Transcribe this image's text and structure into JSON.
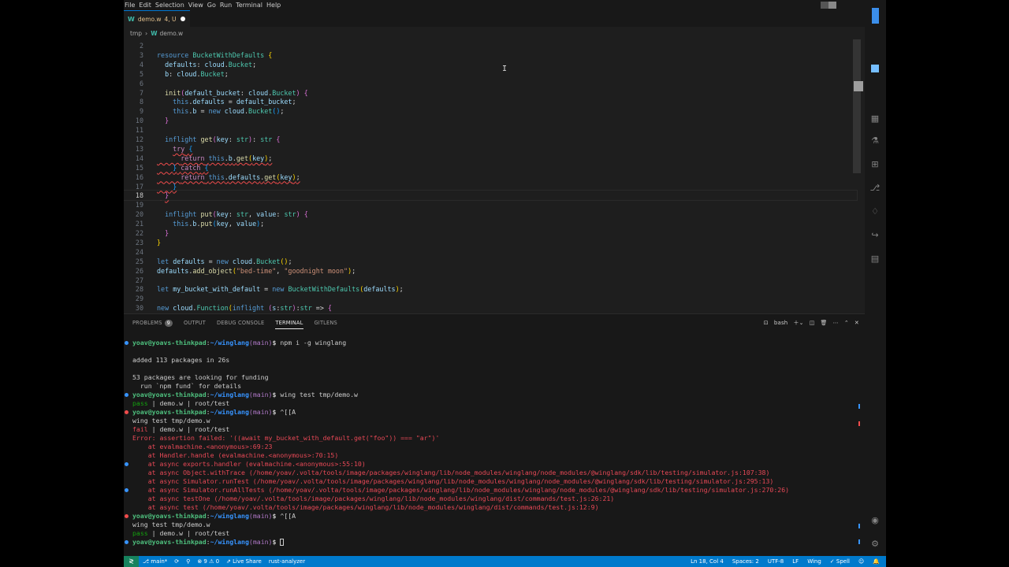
{
  "menubar": {
    "items": [
      "File",
      "Edit",
      "Selection",
      "View",
      "Go",
      "Run",
      "Terminal",
      "Help"
    ]
  },
  "tab": {
    "label": "demo.w",
    "status": "4, U"
  },
  "breadcrumb": {
    "folder": "tmp",
    "file": "demo.w"
  },
  "editor": {
    "lines": [
      {
        "n": "2",
        "html": ""
      },
      {
        "n": "3",
        "html": "<span class='k'>resource</span> <span class='t'>BucketWithDefaults</span> <span class='bk'>{</span>"
      },
      {
        "n": "4",
        "html": "  <span class='v'>defaults</span>: <span class='v'>cloud</span>.<span class='t'>Bucket</span>;"
      },
      {
        "n": "5",
        "html": "  <span class='v'>b</span>: <span class='v'>cloud</span>.<span class='t'>Bucket</span>;"
      },
      {
        "n": "6",
        "html": ""
      },
      {
        "n": "7",
        "html": "  <span class='f'>init</span><span class='bk2'>(</span><span class='v'>default_bucket</span>: <span class='v'>cloud</span>.<span class='t'>Bucket</span><span class='bk2'>)</span> <span class='bk2'>{</span>"
      },
      {
        "n": "8",
        "html": "    <span class='k'>this</span>.<span class='v'>defaults</span> = <span class='v'>default_bucket</span>;"
      },
      {
        "n": "9",
        "html": "    <span class='k'>this</span>.<span class='v'>b</span> = <span class='k'>new</span> <span class='v'>cloud</span>.<span class='t'>Bucket</span><span class='bk3'>()</span>;"
      },
      {
        "n": "10",
        "html": "  <span class='bk2'>}</span>"
      },
      {
        "n": "11",
        "html": ""
      },
      {
        "n": "12",
        "html": "  <span class='k'>inflight</span> <span class='f'>get</span><span class='bk2'>(</span><span class='v'>key</span>: <span class='t'>str</span><span class='bk2'>)</span>: <span class='t'>str</span> <span class='bk2'>{</span>"
      },
      {
        "n": "13",
        "html": "    <span class='squig'><span class='kc'>try</span> <span class='bk3'>{</span></span>"
      },
      {
        "n": "14",
        "html": "<span class='squig'>      <span class='kc'>return</span> <span class='k'>this</span>.<span class='v'>b</span>.<span class='f'>get</span><span class='bk'>(</span><span class='v'>key</span><span class='bk'>)</span>;</span>"
      },
      {
        "n": "15",
        "html": "<span class='squig'>    <span class='bk3'>}</span> <span class='kc'>catch</span> <span class='bk3'>{</span></span>"
      },
      {
        "n": "16",
        "html": "<span class='squig'>      <span class='kc'>return</span> <span class='k'>this</span>.<span class='v'>defaults</span>.<span class='f'>get</span><span class='bk'>(</span><span class='v'>key</span><span class='bk'>)</span>;</span>"
      },
      {
        "n": "17",
        "html": "<span class='squig'>    <span class='bk3'>}</span></span>"
      },
      {
        "n": "18",
        "html": "<span class='squig'>  <span class='bk2'>}</span></span>"
      },
      {
        "n": "19",
        "html": ""
      },
      {
        "n": "20",
        "html": "  <span class='k'>inflight</span> <span class='f'>put</span><span class='bk2'>(</span><span class='v'>key</span>: <span class='t'>str</span>, <span class='v'>value</span>: <span class='t'>str</span><span class='bk2'>)</span> <span class='bk2'>{</span>"
      },
      {
        "n": "21",
        "html": "    <span class='k'>this</span>.<span class='v'>b</span>.<span class='f'>put</span><span class='bk3'>(</span><span class='v'>key</span>, <span class='v'>value</span><span class='bk3'>)</span>;"
      },
      {
        "n": "22",
        "html": "  <span class='bk2'>}</span>"
      },
      {
        "n": "23",
        "html": "<span class='bk'>}</span>"
      },
      {
        "n": "24",
        "html": ""
      },
      {
        "n": "25",
        "html": "<span class='k'>let</span> <span class='v'>defaults</span> = <span class='k'>new</span> <span class='v'>cloud</span>.<span class='t'>Bucket</span><span class='bk'>()</span>;"
      },
      {
        "n": "26",
        "html": "<span class='v'>defaults</span>.<span class='f'>add_object</span><span class='bk'>(</span><span class='s'>\"bed-time\"</span>, <span class='s'>\"goodnight moon\"</span><span class='bk'>)</span>;"
      },
      {
        "n": "27",
        "html": ""
      },
      {
        "n": "28",
        "html": "<span class='k'>let</span> <span class='v'>my_bucket_with_default</span> = <span class='k'>new</span> <span class='t'>BucketWithDefaults</span><span class='bk'>(</span><span class='v'>defaults</span><span class='bk'>)</span>;"
      },
      {
        "n": "29",
        "html": ""
      },
      {
        "n": "30",
        "html": "<span class='k'>new</span> <span class='v'>cloud</span>.<span class='t'>Function</span><span class='bk'>(</span><span class='k'>inflight</span> <span class='bk2'>(</span><span class='v'>s</span>:<span class='t'>str</span><span class='bk2'>)</span>:<span class='t'>str</span> => <span class='bk2'>{</span>"
      }
    ]
  },
  "panel": {
    "tabs": [
      "PROBLEMS",
      "OUTPUT",
      "DEBUG CONSOLE",
      "TERMINAL",
      "GITLENS"
    ],
    "problems_count": "9",
    "shell": "bash"
  },
  "terminal": {
    "lines": [
      {
        "dot": "blue",
        "html": "<span class='pu'>yoav@yoavs-thinkpad</span>:<span class='pp'>~/winglang</span><span class='pb'>(main)</span><span class='ps'>$</span> npm i -g winglang"
      },
      {
        "dot": "",
        "html": ""
      },
      {
        "dot": "",
        "html": "added 113 packages in 26s"
      },
      {
        "dot": "",
        "html": ""
      },
      {
        "dot": "",
        "html": "53 packages are looking for funding"
      },
      {
        "dot": "",
        "html": "  run `npm fund` for details"
      },
      {
        "dot": "blue",
        "html": "<span class='pu'>yoav@yoavs-thinkpad</span>:<span class='pp'>~/winglang</span><span class='pb'>(main)</span><span class='ps'>$</span> wing test tmp/demo.w"
      },
      {
        "dot": "",
        "html": "<span class='pass'>pass</span> | demo.w | root/test"
      },
      {
        "dot": "red",
        "html": "<span class='pu'>yoav@yoavs-thinkpad</span>:<span class='pp'>~/winglang</span><span class='pb'>(main)</span><span class='ps'>$</span> ^[[A"
      },
      {
        "dot": "",
        "html": "wing test tmp/demo.w"
      },
      {
        "dot": "",
        "html": "<span class='fail'>fail</span> | demo.w | root/test"
      },
      {
        "dot": "",
        "html": "<span class='err'>Error: assertion failed: '((await my_bucket_with_default.get(\"foo\")) === \"ar\")'</span>"
      },
      {
        "dot": "",
        "html": "<span class='err'>    at evalmachine.&lt;anonymous&gt;:69:23</span>"
      },
      {
        "dot": "",
        "html": "<span class='err'>    at Handler.handle (evalmachine.&lt;anonymous&gt;:70:15)</span>"
      },
      {
        "dot": "blue",
        "html": "<span class='err'>    at async exports.handler (evalmachine.&lt;anonymous&gt;:55:10)</span>"
      },
      {
        "dot": "",
        "html": "<span class='err'>    at async Object.withTrace (/home/yoav/.volta/tools/image/packages/winglang/lib/node_modules/winglang/node_modules/@winglang/sdk/lib/testing/simulator.js:107:38)</span>"
      },
      {
        "dot": "",
        "html": "<span class='err'>    at async Simulator.runTest (/home/yoav/.volta/tools/image/packages/winglang/lib/node_modules/winglang/node_modules/@winglang/sdk/lib/testing/simulator.js:295:13)</span>"
      },
      {
        "dot": "blue",
        "html": "<span class='err'>    at async Simulator.runAllTests (/home/yoav/.volta/tools/image/packages/winglang/lib/node_modules/winglang/node_modules/@winglang/sdk/lib/testing/simulator.js:270:26)</span>"
      },
      {
        "dot": "",
        "html": "<span class='err'>    at async testOne (/home/yoav/.volta/tools/image/packages/winglang/lib/node_modules/winglang/dist/commands/test.js:26:21)</span>"
      },
      {
        "dot": "",
        "html": "<span class='err'>    at async test (/home/yoav/.volta/tools/image/packages/winglang/lib/node_modules/winglang/dist/commands/test.js:12:9)</span>"
      },
      {
        "dot": "red",
        "html": "<span class='pu'>yoav@yoavs-thinkpad</span>:<span class='pp'>~/winglang</span><span class='pb'>(main)</span><span class='ps'>$</span> ^[[A"
      },
      {
        "dot": "",
        "html": "wing test tmp/demo.w"
      },
      {
        "dot": "",
        "html": "<span class='pass'>pass</span> | demo.w | root/test"
      },
      {
        "dot": "blue",
        "html": "<span class='pu'>yoav@yoavs-thinkpad</span>:<span class='pp'>~/winglang</span><span class='pb'>(main)</span><span class='ps'>$</span> <span class='term-cursor'></span>"
      }
    ]
  },
  "statusbar": {
    "branch": "main*",
    "problems": "⊗ 9 ⚠ 0",
    "live_share": "Live Share",
    "rust": "rust-analyzer",
    "position": "Ln 18, Col 4",
    "spaces": "Spaces: 2",
    "encoding": "UTF-8",
    "eol": "LF",
    "language": "Wing",
    "spell": "✓ Spell"
  }
}
